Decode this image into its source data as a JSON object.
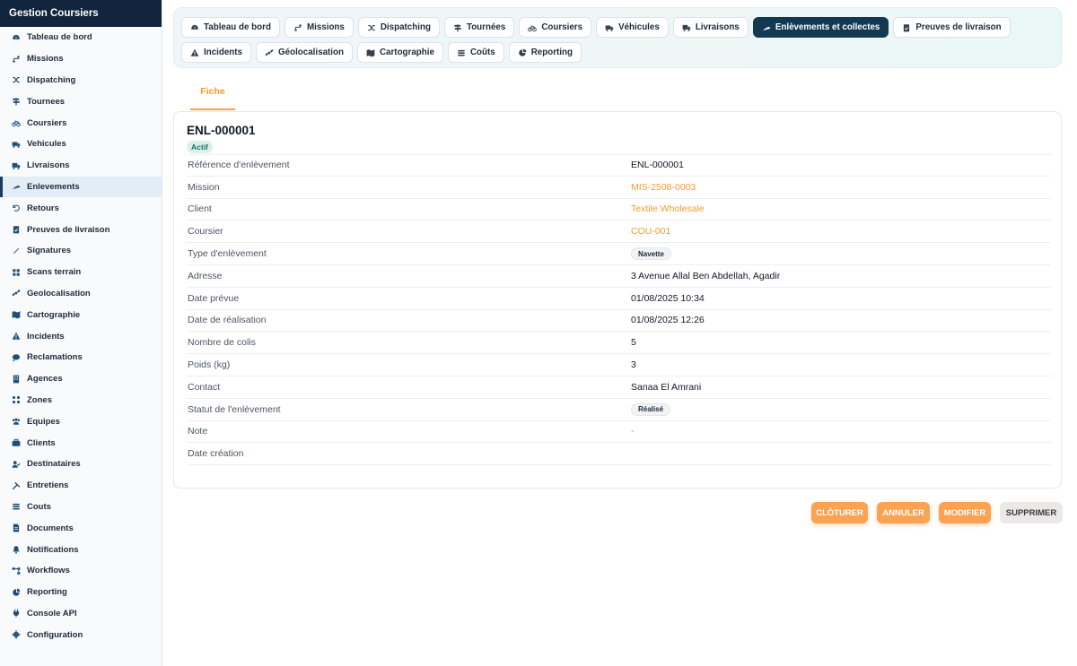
{
  "app": {
    "brand": "Gestion Coursiers"
  },
  "sidebar": {
    "items": [
      {
        "label": "Tableau de bord",
        "icon": "dashboard-icon"
      },
      {
        "label": "Missions",
        "icon": "route-icon"
      },
      {
        "label": "Dispatching",
        "icon": "shuffle-icon"
      },
      {
        "label": "Tournees",
        "icon": "signpost-icon"
      },
      {
        "label": "Coursiers",
        "icon": "bicycle-icon"
      },
      {
        "label": "Vehicules",
        "icon": "truck-icon"
      },
      {
        "label": "Livraisons",
        "icon": "delivery-truck-icon"
      },
      {
        "label": "Enlevements",
        "icon": "pickup-icon",
        "active": true
      },
      {
        "label": "Retours",
        "icon": "undo-icon"
      },
      {
        "label": "Preuves de livraison",
        "icon": "clipboard-check-icon"
      },
      {
        "label": "Signatures",
        "icon": "signature-icon"
      },
      {
        "label": "Scans terrain",
        "icon": "scan-icon"
      },
      {
        "label": "Geolocalisation",
        "icon": "satellite-icon"
      },
      {
        "label": "Cartographie",
        "icon": "map-icon"
      },
      {
        "label": "Incidents",
        "icon": "warning-icon"
      },
      {
        "label": "Reclamations",
        "icon": "chat-icon"
      },
      {
        "label": "Agences",
        "icon": "building-icon"
      },
      {
        "label": "Zones",
        "icon": "zones-icon"
      },
      {
        "label": "Equipes",
        "icon": "team-icon"
      },
      {
        "label": "Clients",
        "icon": "briefcase-icon"
      },
      {
        "label": "Destinataires",
        "icon": "user-check-icon"
      },
      {
        "label": "Entretiens",
        "icon": "tools-icon"
      },
      {
        "label": "Couts",
        "icon": "coins-icon"
      },
      {
        "label": "Documents",
        "icon": "document-icon"
      },
      {
        "label": "Notifications",
        "icon": "bell-icon"
      },
      {
        "label": "Workflows",
        "icon": "workflow-icon"
      },
      {
        "label": "Reporting",
        "icon": "pie-chart-icon"
      },
      {
        "label": "Console API",
        "icon": "plug-icon"
      },
      {
        "label": "Configuration",
        "icon": "gear-icon"
      }
    ]
  },
  "modules": [
    {
      "label": "Tableau de bord",
      "icon": "dashboard-icon"
    },
    {
      "label": "Missions",
      "icon": "route-icon"
    },
    {
      "label": "Dispatching",
      "icon": "shuffle-icon"
    },
    {
      "label": "Tournées",
      "icon": "signpost-icon"
    },
    {
      "label": "Coursiers",
      "icon": "bicycle-icon"
    },
    {
      "label": "Véhicules",
      "icon": "truck-icon"
    },
    {
      "label": "Livraisons",
      "icon": "delivery-truck-icon"
    },
    {
      "label": "Enlèvements et collectes",
      "icon": "pickup-icon",
      "active": true
    },
    {
      "label": "Preuves de livraison",
      "icon": "clipboard-check-icon"
    },
    {
      "label": "Incidents",
      "icon": "warning-icon"
    },
    {
      "label": "Géolocalisation",
      "icon": "satellite-icon"
    },
    {
      "label": "Cartographie",
      "icon": "map-icon"
    },
    {
      "label": "Coûts",
      "icon": "coins-icon"
    },
    {
      "label": "Reporting",
      "icon": "pie-chart-icon"
    }
  ],
  "tab": {
    "label": "Fiche"
  },
  "record": {
    "title": "ENL-000001",
    "status": "Actif",
    "fields": [
      {
        "label": "Référence d'enlèvement",
        "value": "ENL-000001",
        "kind": "text"
      },
      {
        "label": "Mission",
        "value": "MIS-2508-0003",
        "kind": "link"
      },
      {
        "label": "Client",
        "value": "Textile Wholesale",
        "kind": "link"
      },
      {
        "label": "Coursier",
        "value": "COU-001",
        "kind": "link"
      },
      {
        "label": "Type d'enlèvement",
        "value": "Navette",
        "kind": "chip"
      },
      {
        "label": "Adresse",
        "value": "3 Avenue Allal Ben Abdellah, Agadir",
        "kind": "text"
      },
      {
        "label": "Date prévue",
        "value": "01/08/2025 10:34",
        "kind": "text"
      },
      {
        "label": "Date de réalisation",
        "value": "01/08/2025 12:26",
        "kind": "text"
      },
      {
        "label": "Nombre de colis",
        "value": "5",
        "kind": "text"
      },
      {
        "label": "Poids (kg)",
        "value": "3",
        "kind": "text"
      },
      {
        "label": "Contact",
        "value": "Sanaa El Amrani",
        "kind": "text"
      },
      {
        "label": "Statut de l'enlèvement",
        "value": "Réalisé",
        "kind": "chip"
      },
      {
        "label": "Note",
        "value": "-",
        "kind": "muted"
      },
      {
        "label": "Date création",
        "value": "",
        "kind": "text"
      }
    ]
  },
  "actions": {
    "close": "CLÔTURER",
    "cancel": "ANNULER",
    "edit": "MODIFIER",
    "delete": "SUPPRIMER"
  },
  "colors": {
    "accent": "#f59a33",
    "brand": "#10243e",
    "active_pill": "#123852"
  }
}
